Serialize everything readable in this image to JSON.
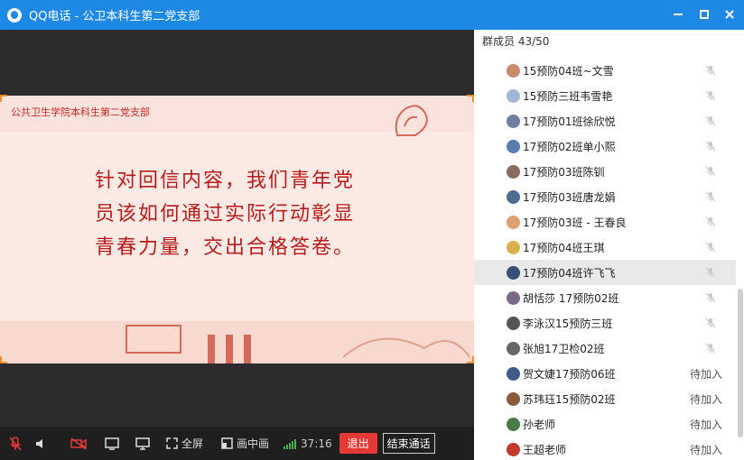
{
  "window": {
    "title": "QQ电话 - 公卫本科生第二党支部"
  },
  "slide": {
    "org": "公共卫生学院本科生第二党支部",
    "lines": [
      "针对回信内容，我们青年党",
      "员该如何通过实际行动彰显",
      "青春力量，交出合格答卷。"
    ]
  },
  "controls": {
    "fullscreen": "全屏",
    "pip": "画中画",
    "timer": "37:16",
    "exit": "退出",
    "end_call": "结束通话"
  },
  "members": {
    "header": "群成员 43/50",
    "list": [
      {
        "name": "15预防04班~文雪",
        "status": "",
        "avatar_color": "#c98b6b"
      },
      {
        "name": "15预防三班韦雪艳",
        "status": "",
        "avatar_color": "#a0b6d6"
      },
      {
        "name": "17预防01班徐欣悦",
        "status": "",
        "avatar_color": "#6f7fa0"
      },
      {
        "name": "17预防02班单小熙",
        "status": "",
        "avatar_color": "#5a7db0"
      },
      {
        "name": "17预防03班陈钏",
        "status": "",
        "avatar_color": "#8a6b63"
      },
      {
        "name": "17预防03班唐龙娟",
        "status": "",
        "avatar_color": "#4d6a8f"
      },
      {
        "name": "17预防03班 - 王春良",
        "status": "",
        "avatar_color": "#e0a070"
      },
      {
        "name": "17预防04班王琪",
        "status": "",
        "avatar_color": "#d9b04a"
      },
      {
        "name": "17预防04班许飞飞",
        "status": "",
        "avatar_color": "#3a4f7a"
      },
      {
        "name": "胡恬莎 17预防02班",
        "status": "",
        "avatar_color": "#7a6a88"
      },
      {
        "name": "李泳汉15预防三班",
        "status": "",
        "avatar_color": "#555555"
      },
      {
        "name": "张旭17卫检02班",
        "status": "",
        "avatar_color": "#666666"
      },
      {
        "name": "贺文婕17预防06班",
        "status": "待加入",
        "avatar_color": "#3e5a88"
      },
      {
        "name": "苏玮珏15预防02班",
        "status": "待加入",
        "avatar_color": "#8a5a3a"
      },
      {
        "name": "孙老师",
        "status": "待加入",
        "avatar_color": "#4a7a4a"
      },
      {
        "name": "王超老师",
        "status": "待加入",
        "avatar_color": "#c0392b"
      }
    ]
  },
  "colors": {
    "titlebar": "#1e88e5",
    "exit": "#e53935",
    "slide_text": "#b71c1c"
  }
}
